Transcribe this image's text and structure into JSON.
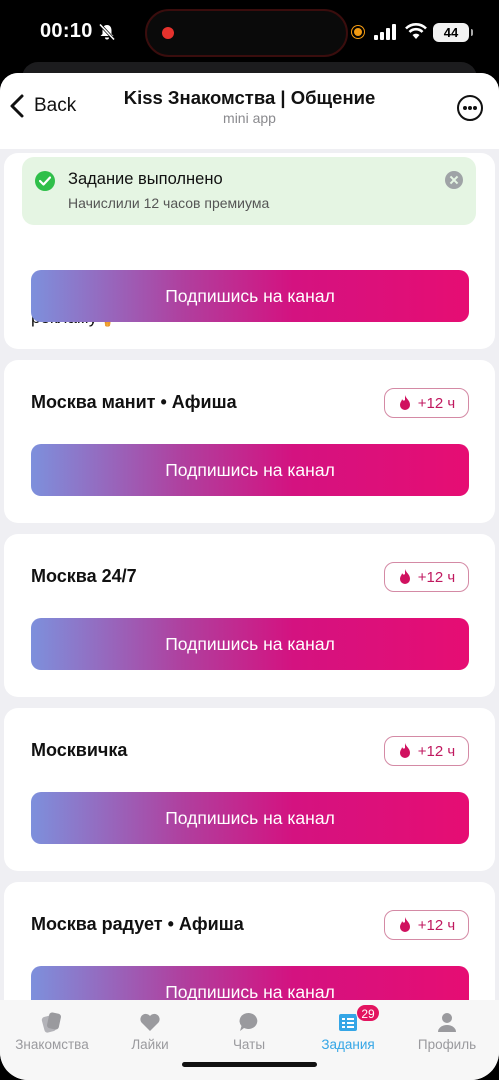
{
  "status_bar": {
    "time": "00:10",
    "battery": "44",
    "icons": [
      "bell-off-icon",
      "signal-icon",
      "wifi-icon",
      "battery-icon"
    ]
  },
  "header": {
    "back_label": "Back",
    "title": "Kiss Знакомства | Общение",
    "subtitle": "mini app"
  },
  "toast": {
    "title": "Задание выполнено",
    "description": "Начислили 12 часов премиума"
  },
  "partial_card": {
    "visible_text": "рекламу🍦",
    "button_label": "Подпишись на канал"
  },
  "tasks": [
    {
      "title": "Москва манит • Афиша",
      "reward": "+12 ч",
      "button_label": "Подпишись на канал"
    },
    {
      "title": "Москва 24/7",
      "reward": "+12 ч",
      "button_label": "Подпишись на канал"
    },
    {
      "title": "Москвичка",
      "reward": "+12 ч",
      "button_label": "Подпишись на канал"
    },
    {
      "title": "Москва радует • Афиша",
      "reward": "+12 ч",
      "button_label": "Подпишись на канал"
    }
  ],
  "tabs": [
    {
      "label": "Знакомства",
      "icon": "cards-icon",
      "active": false
    },
    {
      "label": "Лайки",
      "icon": "heart-icon",
      "active": false
    },
    {
      "label": "Чаты",
      "icon": "chat-bubble-icon",
      "active": false
    },
    {
      "label": "Задания",
      "icon": "task-list-icon",
      "active": true,
      "badge": "29"
    },
    {
      "label": "Профиль",
      "icon": "person-icon",
      "active": false
    }
  ],
  "colors": {
    "accent": "#e60d73",
    "gradient_start": "#7d90dc",
    "active_tab": "#35a6e6",
    "toast_bg": "#e5f5e3",
    "success": "#2fbf4a"
  }
}
